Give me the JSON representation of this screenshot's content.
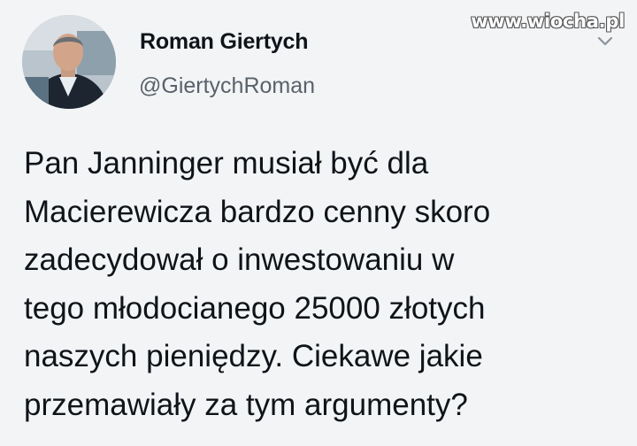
{
  "watermark": {
    "text": "www.wiocha.pl"
  },
  "author": {
    "display_name": "Roman Giertych",
    "handle": "@GiertychRoman",
    "avatar_icon": "profile-photo"
  },
  "tweet": {
    "lines": [
      "Pan Janninger musiał być dla",
      "Macierewicza bardzo cenny skoro",
      "zadecydował o inwestowaniu w",
      "tego młodocianego 25000 złotych",
      "naszych pieniędzy. Ciekawe jakie",
      "przemawiały za tym argumenty?"
    ]
  },
  "icons": {
    "menu": "chevron-down-icon"
  },
  "colors": {
    "background": "#f3f4f6",
    "text_primary": "#0f1419",
    "text_secondary": "#59626b"
  }
}
